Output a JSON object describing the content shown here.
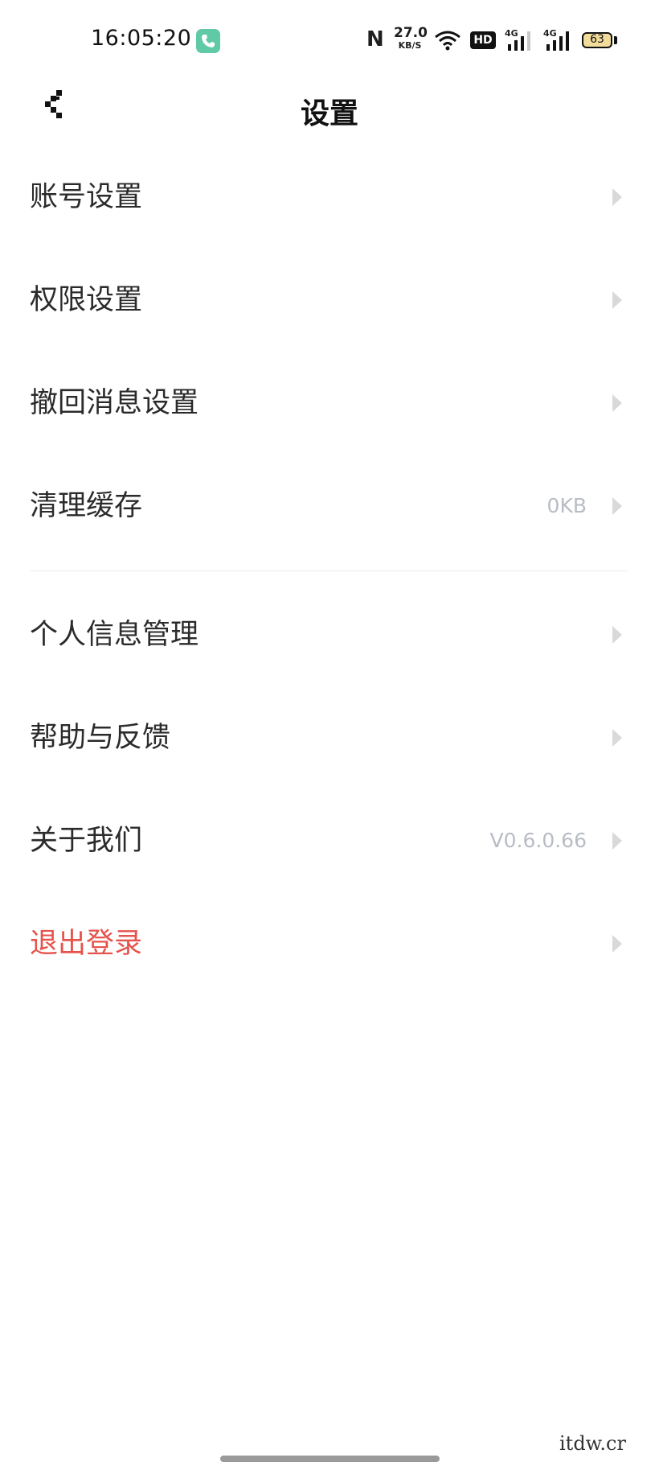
{
  "status_bar": {
    "time": "16:05:20",
    "nfc": "N",
    "net_speed_value": "27.0",
    "net_speed_unit": "KB/S",
    "hd_label": "HD",
    "signal1_label": "4G",
    "signal2_label": "4G",
    "battery": "63",
    "call_badge_color": "#5fcaa5"
  },
  "nav": {
    "title": "设置",
    "back_icon": "chevron-left-icon"
  },
  "items": [
    {
      "label": "账号设置",
      "value": ""
    },
    {
      "label": "权限设置",
      "value": ""
    },
    {
      "label": "撤回消息设置",
      "value": ""
    },
    {
      "label": "清理缓存",
      "value": "0KB"
    },
    {
      "label": "个人信息管理",
      "value": ""
    },
    {
      "label": "帮助与反馈",
      "value": ""
    },
    {
      "label": "关于我们",
      "value": "V0.6.0.66"
    },
    {
      "label": "退出登录",
      "value": "",
      "color": "#e5534b"
    }
  ],
  "watermark": "itdw.cr"
}
